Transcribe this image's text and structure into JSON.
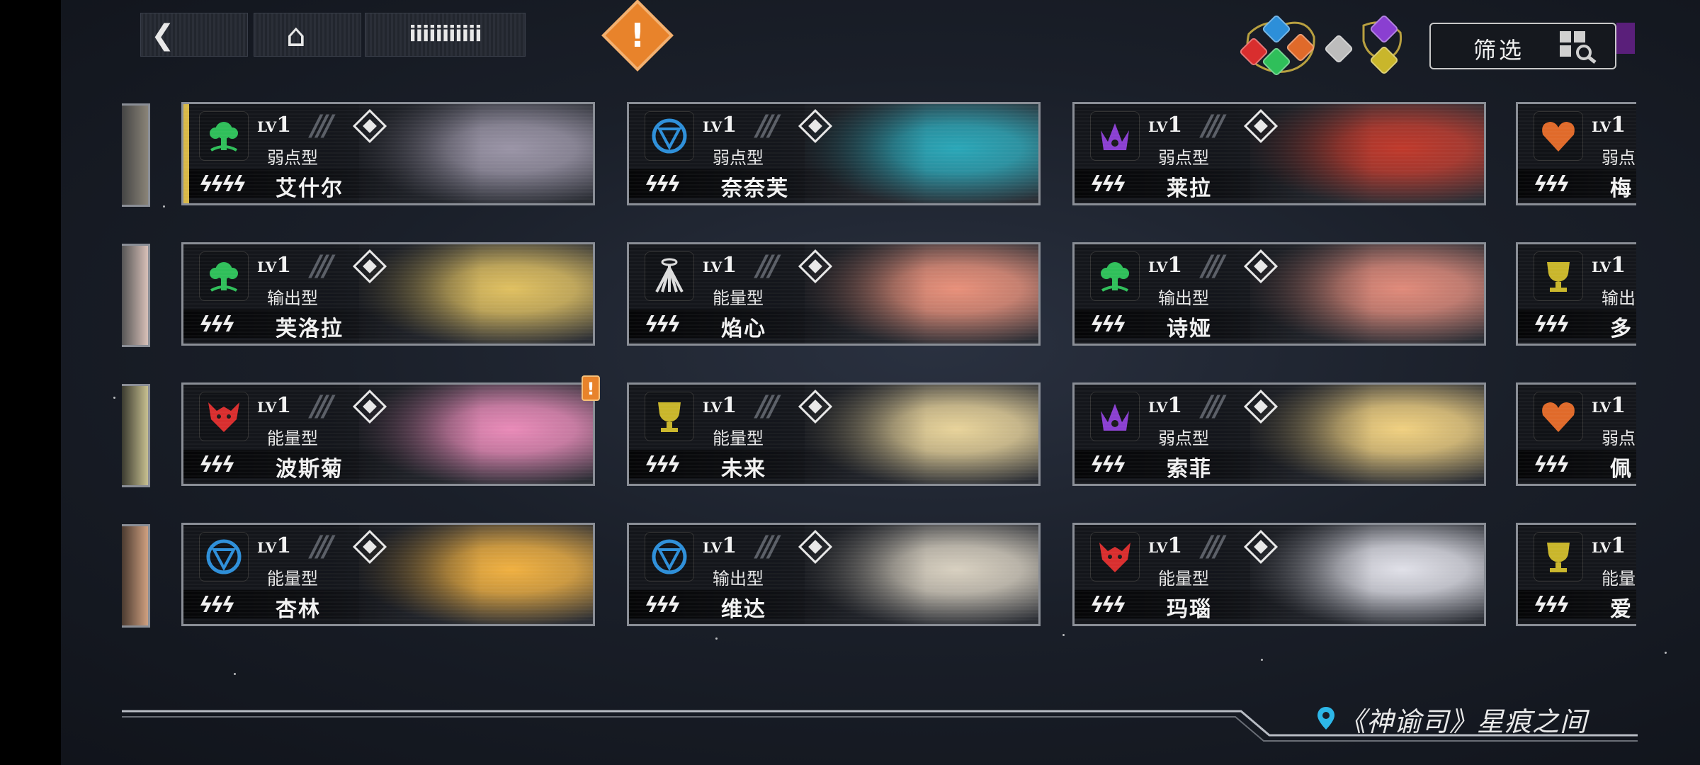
{
  "top_bar": {
    "player_name": "iiiiiiiiiii",
    "filter_label": "筛选"
  },
  "elements": [
    "green-tree",
    "blue-shield",
    "purple-crown",
    "orange-heart",
    "red-wolf",
    "yellow-trophy",
    "white-wing"
  ],
  "colors": {
    "green": "#2fbf5a",
    "blue": "#2d8fd9",
    "purple": "#8a3fd1",
    "orange": "#e06a2a",
    "red": "#d92e2e",
    "yellow": "#c9b62b",
    "white": "#dcdcdc",
    "alert": "#e8832b"
  },
  "cards": [
    {
      "level": "1",
      "type": "弱点型",
      "name": "艾什尔",
      "element": "green",
      "bolts": "ϟϟϟϟ",
      "accent": "#9a94a6"
    },
    {
      "level": "1",
      "type": "弱点型",
      "name": "奈奈芙",
      "element": "blue",
      "bolts": "ϟϟϟ",
      "accent": "#2aa7b8"
    },
    {
      "level": "1",
      "type": "弱点型",
      "name": "莱拉",
      "element": "purple",
      "bolts": "ϟϟϟ",
      "accent": "#c0392b"
    },
    {
      "level": "1",
      "type": "输出型",
      "name": "芙洛拉",
      "element": "green",
      "bolts": "ϟϟϟ",
      "accent": "#e0c060"
    },
    {
      "level": "1",
      "type": "能量型",
      "name": "焰心",
      "element": "white",
      "bolts": "ϟϟϟ",
      "accent": "#e8907a"
    },
    {
      "level": "1",
      "type": "输出型",
      "name": "诗娅",
      "element": "green",
      "bolts": "ϟϟϟ",
      "accent": "#e08a7a"
    },
    {
      "level": "1",
      "type": "能量型",
      "name": "波斯菊",
      "element": "red",
      "bolts": "ϟϟϟ",
      "accent": "#e98ab8"
    },
    {
      "level": "1",
      "type": "能量型",
      "name": "未来",
      "element": "yellow",
      "bolts": "ϟϟϟ",
      "accent": "#e8d39a"
    },
    {
      "level": "1",
      "type": "弱点型",
      "name": "索菲",
      "element": "purple",
      "bolts": "ϟϟϟ",
      "accent": "#f0d080"
    },
    {
      "level": "1",
      "type": "能量型",
      "name": "杏林",
      "element": "blue",
      "bolts": "ϟϟϟ",
      "accent": "#f0b040"
    },
    {
      "level": "1",
      "type": "输出型",
      "name": "维达",
      "element": "blue",
      "bolts": "ϟϟϟ",
      "accent": "#d8d0c0"
    },
    {
      "level": "1",
      "type": "能量型",
      "name": "玛瑙",
      "element": "red",
      "bolts": "ϟϟϟ",
      "accent": "#e0e0e8"
    }
  ],
  "partial_cards": [
    {
      "level": "1",
      "type": "弱点",
      "name": "梅",
      "element": "orange",
      "bolts": "ϟϟϟ"
    },
    {
      "level": "1",
      "type": "输出",
      "name": "多",
      "element": "yellow",
      "bolts": "ϟϟϟ"
    },
    {
      "level": "1",
      "type": "弱点",
      "name": "佩",
      "element": "orange",
      "bolts": "ϟϟϟ"
    },
    {
      "level": "1",
      "type": "能量",
      "name": "爱",
      "element": "yellow",
      "bolts": "ϟϟϟ"
    }
  ],
  "location": "《神谕司》星痕之间"
}
